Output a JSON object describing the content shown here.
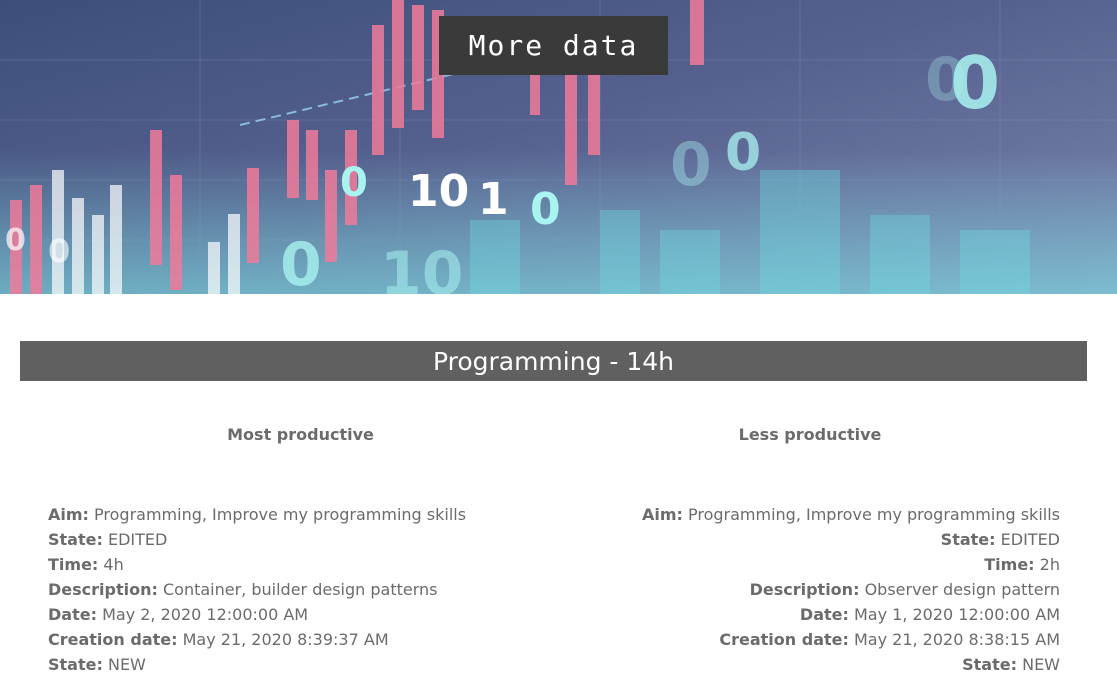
{
  "hero": {
    "button_label": "More data",
    "digits": [
      "0",
      "10",
      "1",
      "0",
      "0",
      "0",
      "0",
      "0",
      "10",
      "0",
      "0",
      "0",
      "0"
    ]
  },
  "category": {
    "title": "Programming - 14h"
  },
  "most_productive": {
    "title": "Most productive",
    "rows": [
      {
        "label": "Aim:",
        "value": "Programming, Improve my programming skills"
      },
      {
        "label": "State:",
        "value": "EDITED"
      },
      {
        "label": "Time:",
        "value": "4h"
      },
      {
        "label": "Description:",
        "value": "Container, builder design patterns"
      },
      {
        "label": "Date:",
        "value": "May 2, 2020 12:00:00 AM"
      },
      {
        "label": "Creation date:",
        "value": "May 21, 2020 8:39:37 AM"
      },
      {
        "label": "State:",
        "value": "NEW"
      }
    ]
  },
  "less_productive": {
    "title": "Less productive",
    "rows": [
      {
        "label": "Aim:",
        "value": "Programming, Improve my programming skills"
      },
      {
        "label": "State:",
        "value": "EDITED"
      },
      {
        "label": "Time:",
        "value": "2h"
      },
      {
        "label": "Description:",
        "value": "Observer design pattern"
      },
      {
        "label": "Date:",
        "value": "May 1, 2020 12:00:00 AM"
      },
      {
        "label": "Creation date:",
        "value": "May 21, 2020 8:38:15 AM"
      },
      {
        "label": "State:",
        "value": "NEW"
      }
    ]
  }
}
